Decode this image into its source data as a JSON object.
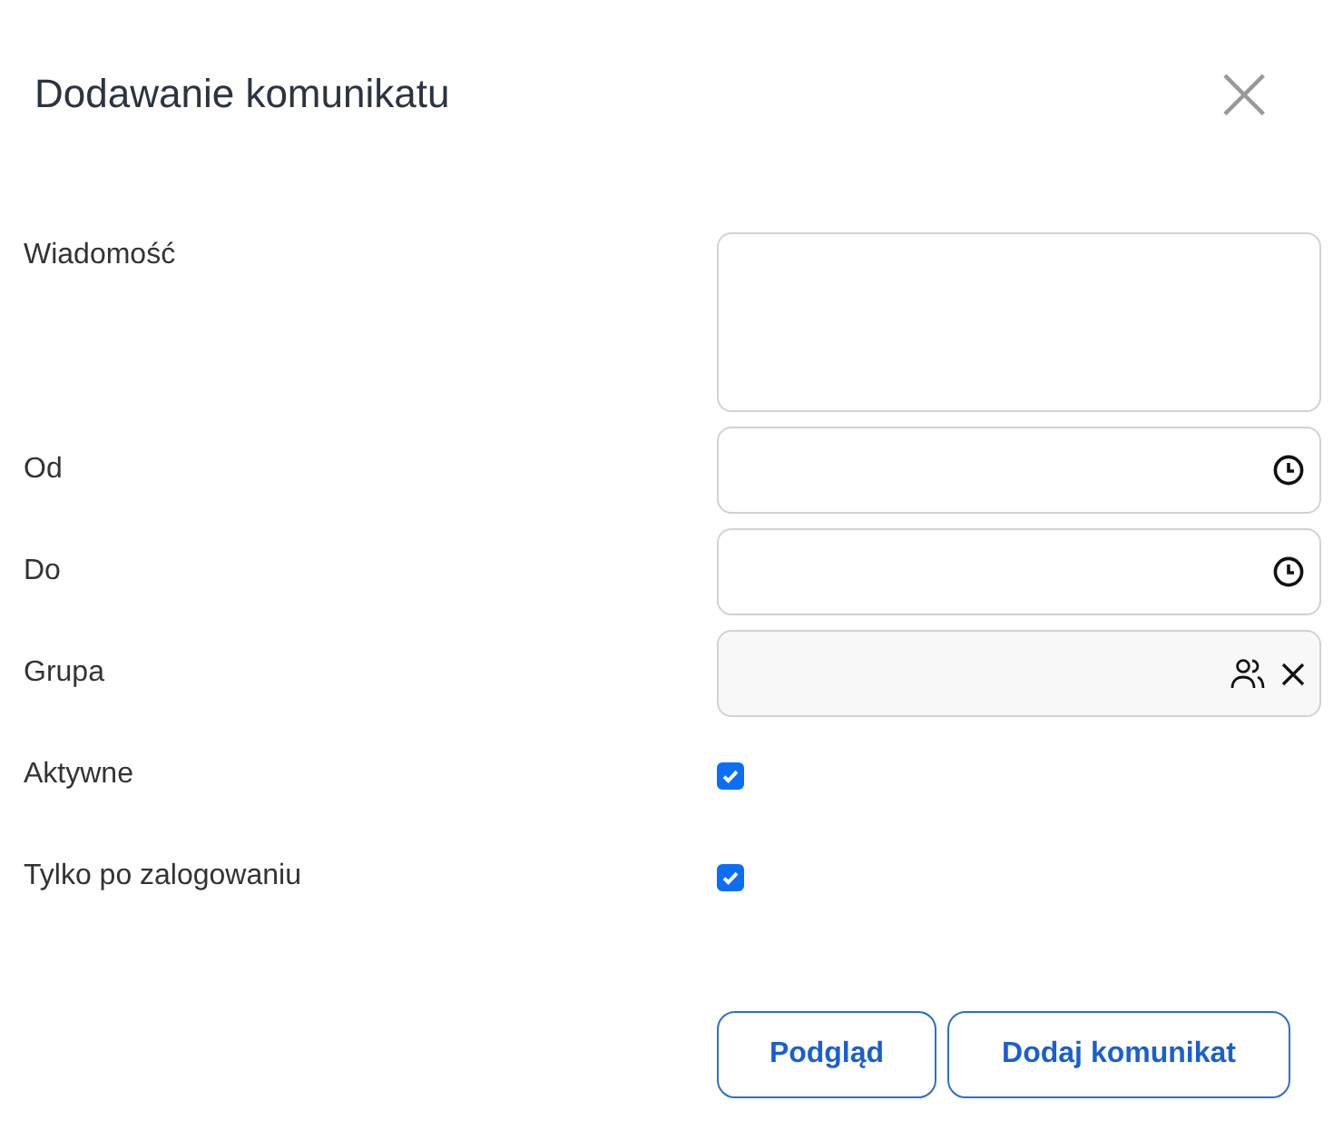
{
  "dialog": {
    "title": "Dodawanie komunikatu",
    "close": "×"
  },
  "fields": [
    {
      "label": "Wiadomość",
      "kind": "textarea"
    },
    {
      "label": "Od",
      "kind": "time"
    },
    {
      "label": "Do",
      "kind": "time"
    },
    {
      "label": "Grupa",
      "kind": "group"
    }
  ],
  "checkboxes": [
    {
      "label": "Aktywne",
      "checked": true
    },
    {
      "label": "Tylko po zalogowaniu",
      "checked": true
    }
  ],
  "buttons": [
    "Podgląd",
    "Dodaj komunikat"
  ]
}
